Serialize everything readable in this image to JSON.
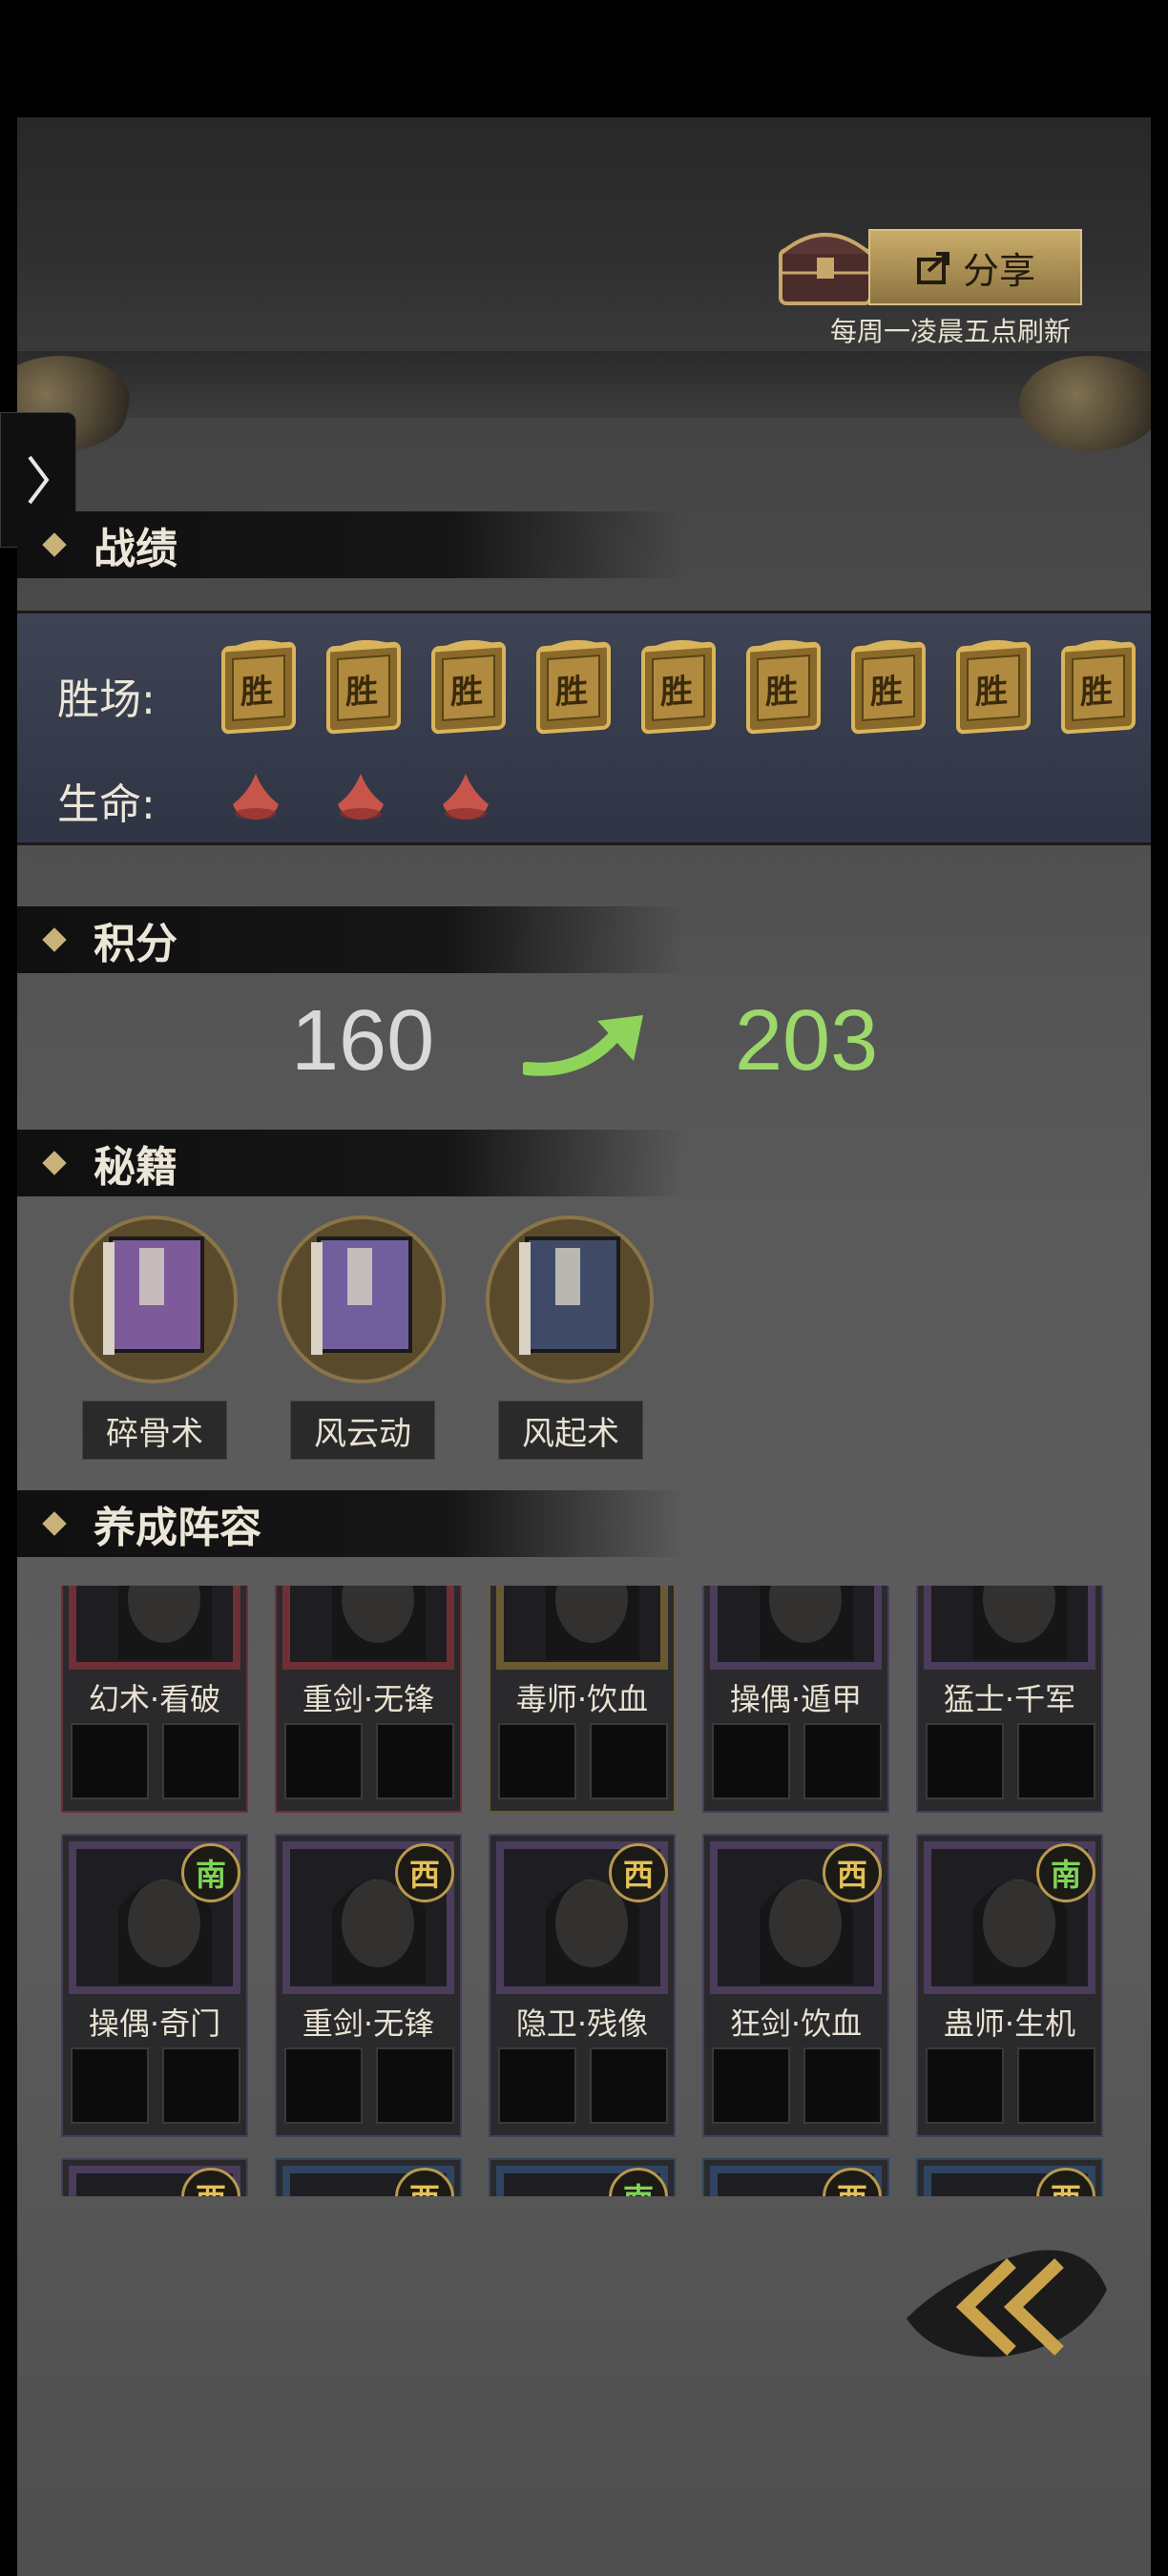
{
  "header": {
    "share_label": "分享",
    "refresh_note": "每周一凌晨五点刷新"
  },
  "record": {
    "title": "战绩",
    "wins_label": "胜场:",
    "win_badge": "胜",
    "wins_count": 9,
    "lives_label": "生命:",
    "lives_count": 3
  },
  "score": {
    "title": "积分",
    "before": "160",
    "after": "203",
    "colors": {
      "before": "#d9d9d9",
      "after": "#9cd86a",
      "arrow": "#8ed45a"
    }
  },
  "manuals": {
    "title": "秘籍",
    "items": [
      {
        "name": "碎骨术",
        "cover": "#7d5a9a"
      },
      {
        "name": "风云动",
        "cover": "#6f5f9d"
      },
      {
        "name": "风起术",
        "cover": "#3e4a66"
      }
    ]
  },
  "lineup": {
    "title": "养成阵容",
    "rows": [
      [
        {
          "name": "幻术·看破",
          "frame": "#6e2f36",
          "badge": ""
        },
        {
          "name": "重剑·无锋",
          "frame": "#6e2f36",
          "badge": ""
        },
        {
          "name": "毒师·饮血",
          "frame": "#6a5a32",
          "badge": ""
        },
        {
          "name": "操偶·遁甲",
          "frame": "#4a3c5a",
          "badge": ""
        },
        {
          "name": "猛士·千军",
          "frame": "#4a3c5a",
          "badge": ""
        }
      ],
      [
        {
          "name": "操偶·奇门",
          "frame": "#4a3c5a",
          "badge": "南"
        },
        {
          "name": "重剑·无锋",
          "frame": "#4a3c5a",
          "badge": "西"
        },
        {
          "name": "隐卫·残像",
          "frame": "#4a3c5a",
          "badge": "西"
        },
        {
          "name": "狂剑·饮血",
          "frame": "#4a3c5a",
          "badge": "西"
        },
        {
          "name": "蛊师·生机",
          "frame": "#4a3c5a",
          "badge": "南"
        }
      ],
      [
        {
          "name": "",
          "frame": "#4a3c5a",
          "badge": "西"
        },
        {
          "name": "",
          "frame": "#2f4460",
          "badge": "西"
        },
        {
          "name": "",
          "frame": "#2f4460",
          "badge": "南"
        },
        {
          "name": "",
          "frame": "#2f4460",
          "badge": "西"
        },
        {
          "name": "",
          "frame": "#2f4460",
          "badge": "西"
        }
      ]
    ]
  }
}
